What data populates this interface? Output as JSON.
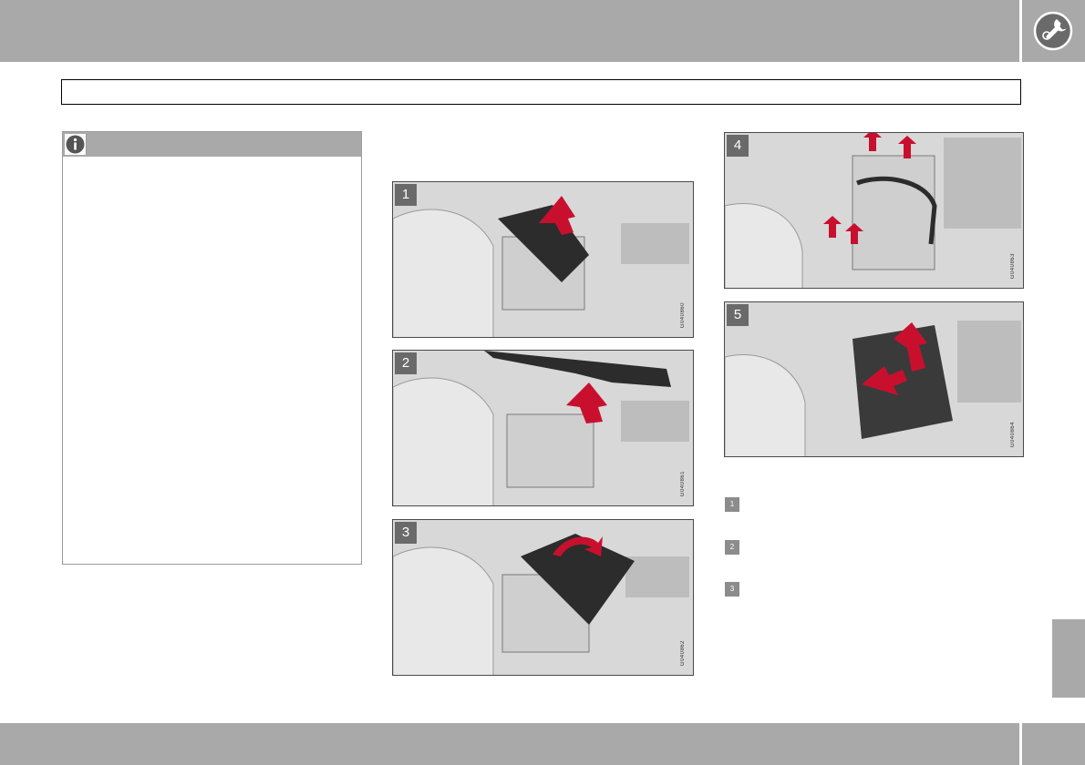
{
  "photos": [
    {
      "number": "1",
      "code": "G040860"
    },
    {
      "number": "2",
      "code": "G040861"
    },
    {
      "number": "3",
      "code": "G040862"
    },
    {
      "number": "4",
      "code": "G040863"
    },
    {
      "number": "5",
      "code": "G040864"
    }
  ],
  "legend": [
    "1",
    "2",
    "3"
  ],
  "icons": {
    "header": "wrench-icon",
    "note": "info-icon"
  },
  "colors": {
    "band": "#a9a9a9",
    "arrow": "#c8102e",
    "tag": "#6a6a6a"
  }
}
